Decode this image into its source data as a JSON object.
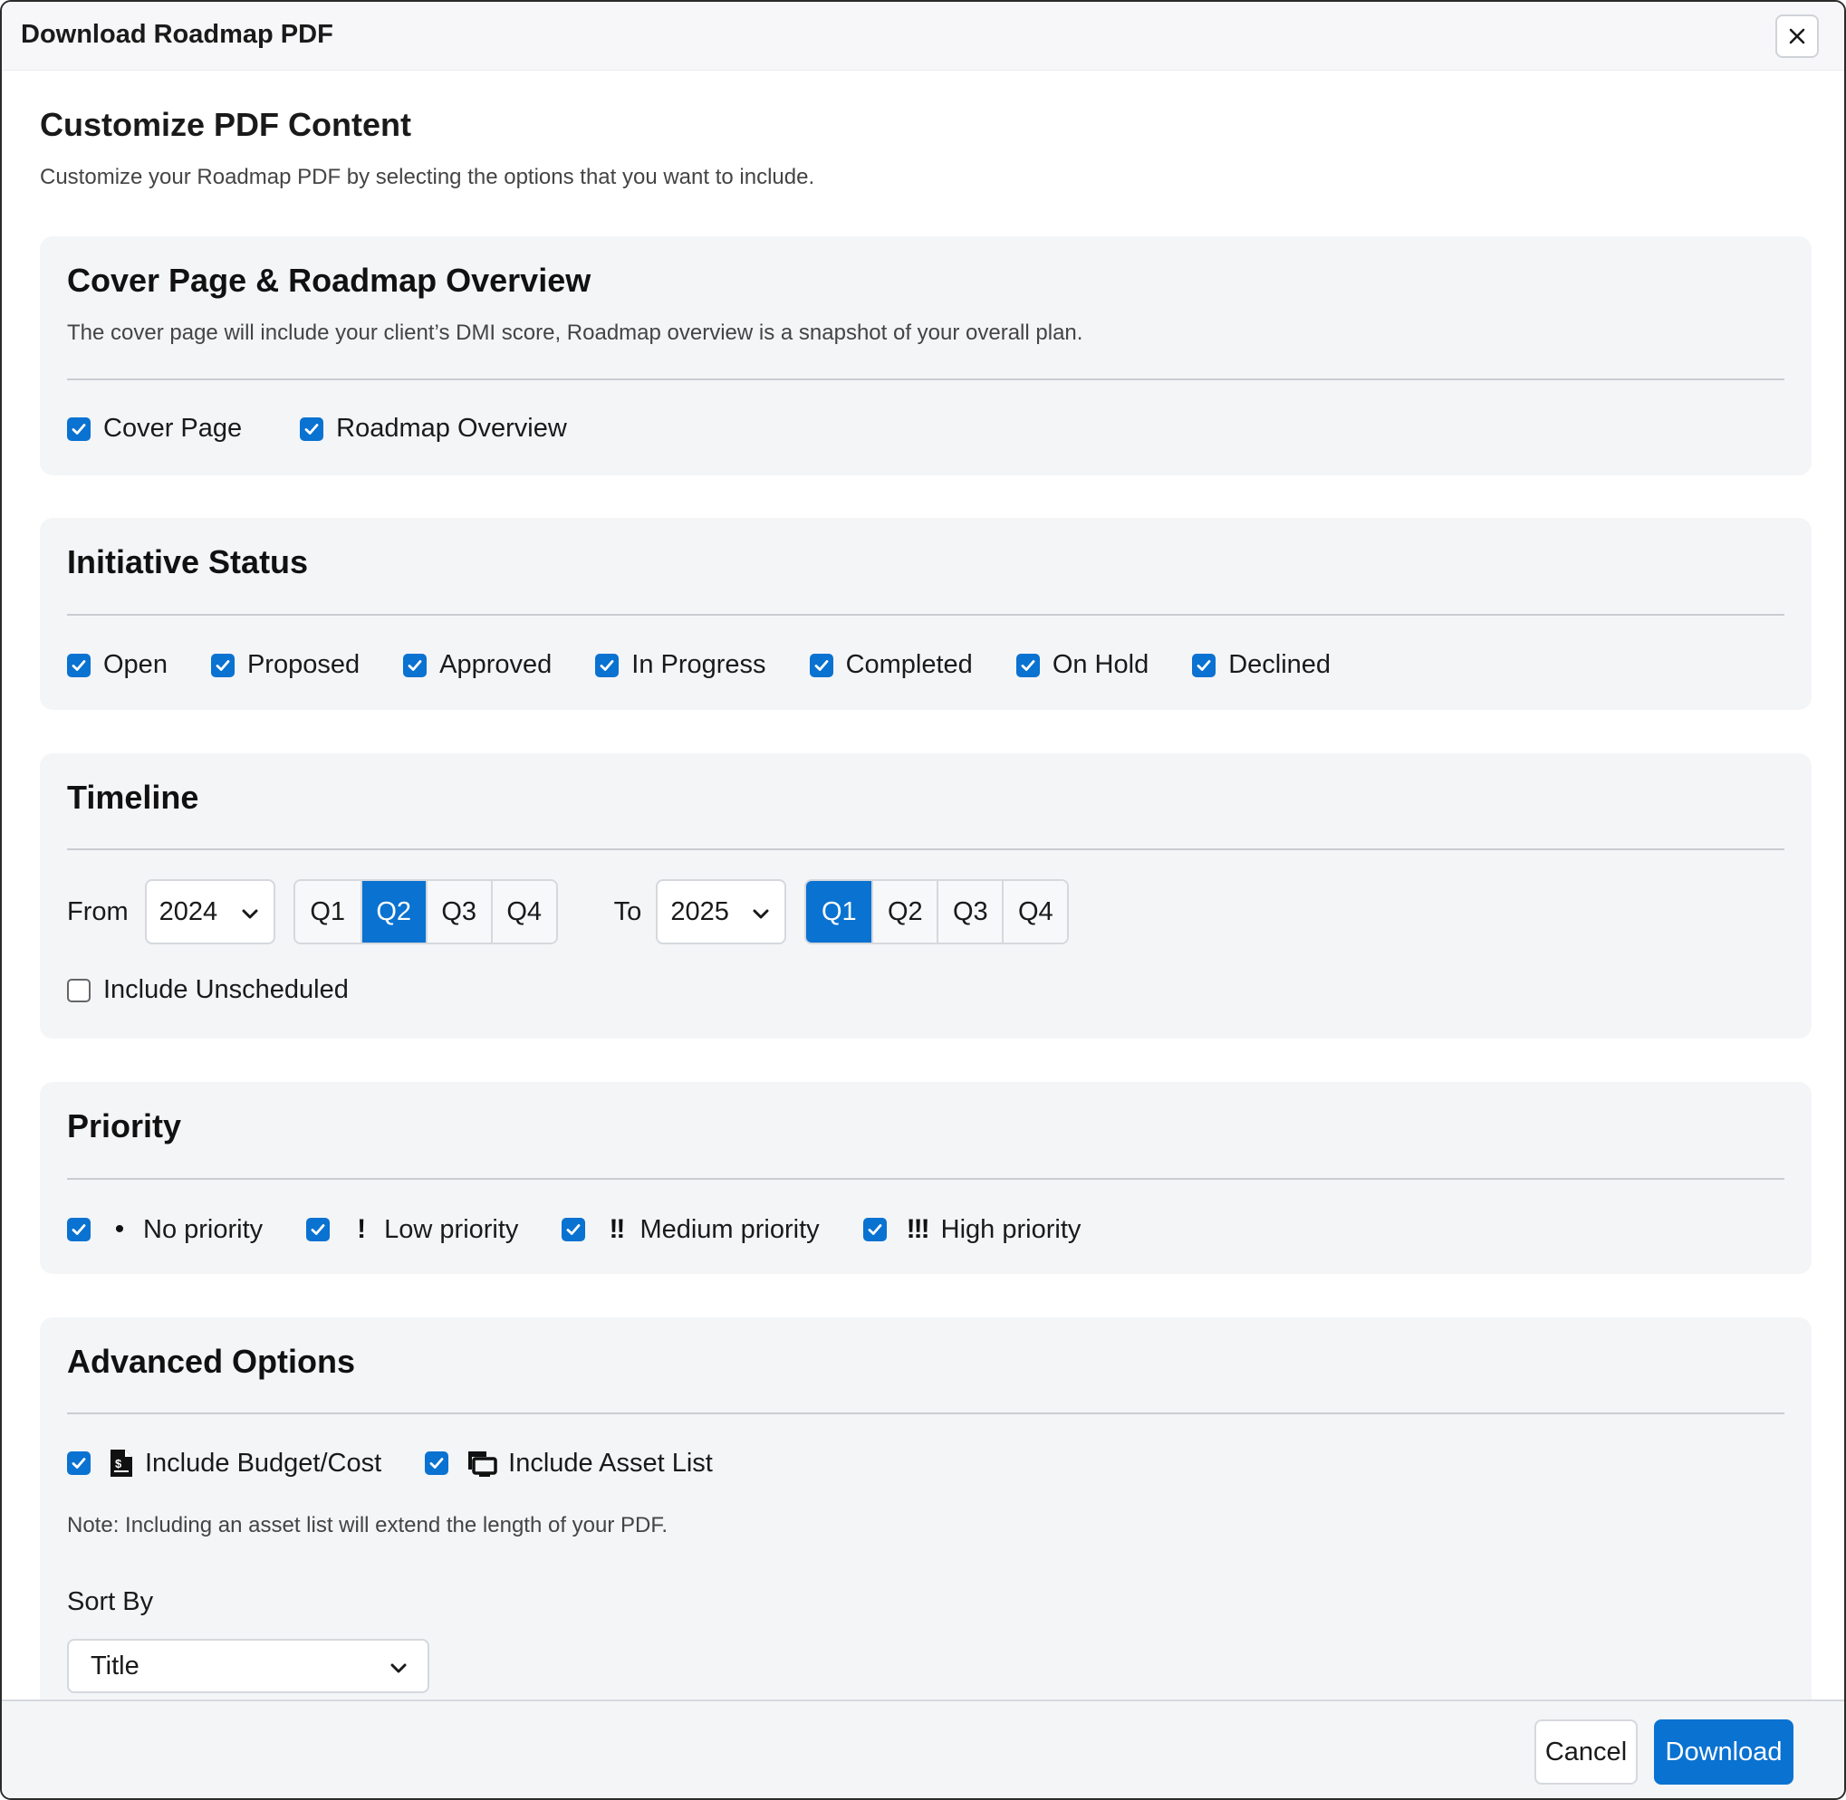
{
  "modal": {
    "title": "Download Roadmap PDF",
    "close_icon": "close-icon"
  },
  "content": {
    "title": "Customize PDF Content",
    "description": "Customize your Roadmap PDF by selecting the options that you want to include."
  },
  "cover": {
    "title": "Cover Page & Roadmap Overview",
    "description": "The cover page will include your client’s DMI score, Roadmap overview is a snapshot of your overall plan.",
    "options": [
      {
        "label": "Cover Page",
        "checked": true
      },
      {
        "label": "Roadmap Overview",
        "checked": true
      }
    ]
  },
  "status": {
    "title": "Initiative Status",
    "options": [
      {
        "label": "Open",
        "checked": true
      },
      {
        "label": "Proposed",
        "checked": true
      },
      {
        "label": "Approved",
        "checked": true
      },
      {
        "label": "In Progress",
        "checked": true
      },
      {
        "label": "Completed",
        "checked": true
      },
      {
        "label": "On Hold",
        "checked": true
      },
      {
        "label": "Declined",
        "checked": true
      }
    ]
  },
  "timeline": {
    "title": "Timeline",
    "from_label": "From",
    "from_year": "2024",
    "from_quarters": [
      "Q1",
      "Q2",
      "Q3",
      "Q4"
    ],
    "from_selected": "Q2",
    "to_label": "To",
    "to_year": "2025",
    "to_quarters": [
      "Q1",
      "Q2",
      "Q3",
      "Q4"
    ],
    "to_selected": "Q1",
    "unscheduled_label": "Include Unscheduled",
    "unscheduled_checked": false
  },
  "priority": {
    "title": "Priority",
    "options": [
      {
        "label": "No priority",
        "icon": "•",
        "icon_name": "dot-icon",
        "checked": true
      },
      {
        "label": "Low priority",
        "icon": "!",
        "icon_name": "exclamation-icon",
        "checked": true
      },
      {
        "label": "Medium priority",
        "icon": "!!",
        "icon_name": "double-exclamation-icon",
        "checked": true
      },
      {
        "label": "High priority",
        "icon": "!!!",
        "icon_name": "triple-exclamation-icon",
        "checked": true
      }
    ]
  },
  "advanced": {
    "title": "Advanced Options",
    "options": [
      {
        "label": "Include Budget/Cost",
        "icon_name": "invoice-dollar-icon",
        "checked": true
      },
      {
        "label": "Include Asset List",
        "icon_name": "computer-asset-icon",
        "checked": true
      }
    ],
    "note": "Note: Including an asset list will extend the length of your PDF.",
    "sort_by_label": "Sort By",
    "sort_by_value": "Title"
  },
  "footer": {
    "cancel_label": "Cancel",
    "download_label": "Download"
  },
  "colors": {
    "accent": "#0a72d1",
    "card_bg": "#f4f5f7"
  }
}
